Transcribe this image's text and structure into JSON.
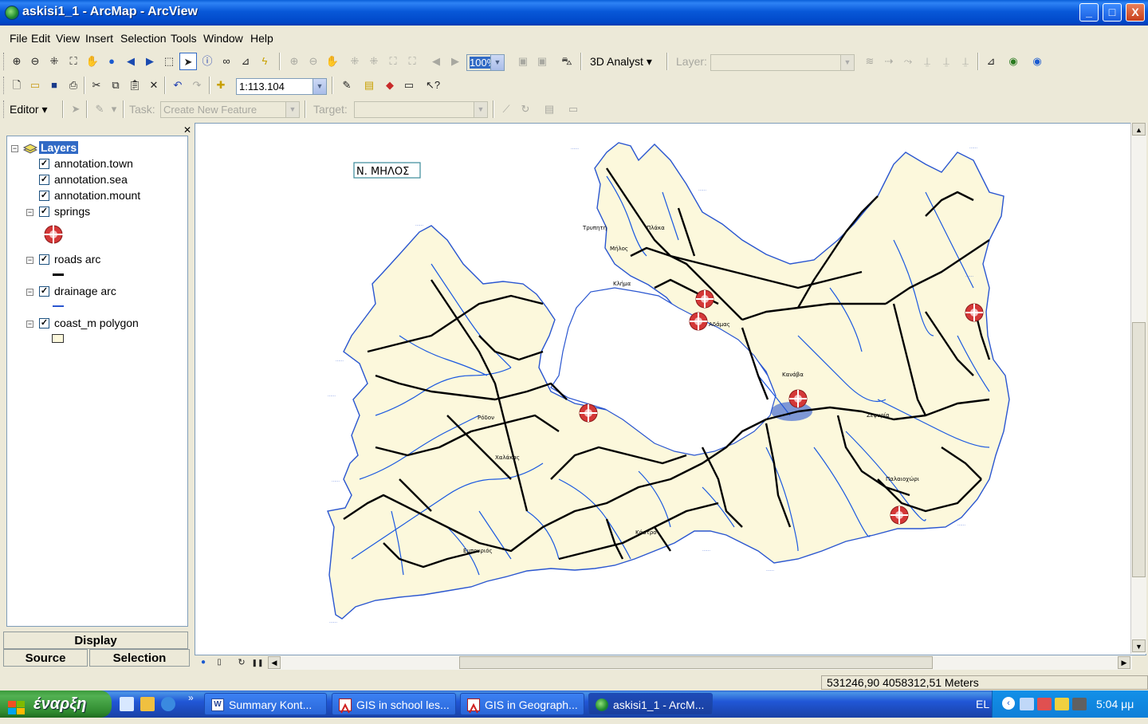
{
  "window": {
    "title": "askisi1_1 - ArcMap - ArcView",
    "buttons": {
      "minimize": "_",
      "maximize": "□",
      "close": "X"
    }
  },
  "menu": [
    "File",
    "Edit",
    "View",
    "Insert",
    "Selection",
    "Tools",
    "Window",
    "Help"
  ],
  "toolbar_tools": {
    "zoom_percent": "100%",
    "analyst_label": "3D Analyst",
    "layer_label": "Layer:",
    "layer_value": ""
  },
  "toolbar_standard": {
    "scale": "1:113.104"
  },
  "toolbar_editor": {
    "editor_label": "Editor",
    "task_label": "Task:",
    "task_value": "Create New Feature",
    "target_label": "Target:",
    "target_value": ""
  },
  "toc": {
    "root_label": "Layers",
    "layers": [
      {
        "name": "annotation.town",
        "checked": true
      },
      {
        "name": "annotation.sea",
        "checked": true
      },
      {
        "name": "annotation.mount",
        "checked": true
      },
      {
        "name": "springs",
        "checked": true,
        "symbol": "spring-symbol-icon"
      },
      {
        "name": "roads arc",
        "checked": true,
        "symbol": "black-line"
      },
      {
        "name": "drainage arc",
        "checked": true,
        "symbol": "blue-line"
      },
      {
        "name": "coast_m polygon",
        "checked": true,
        "symbol": "yellow-fill"
      }
    ],
    "tabs": {
      "display": "Display",
      "source": "Source",
      "selection": "Selection"
    }
  },
  "map": {
    "title_box": "Ν. ΜΗΛΟΣ",
    "labels": {
      "milos": "Μήλος",
      "kastro": "Κάστρο",
      "plaka": "Πλάκα",
      "adamas": "Αδάμας",
      "kanava": "Κανάβα",
      "zefiria": "Ζεφυρία",
      "paliochori": "Παλαιοχώρι",
      "embourios": "Εμπουριός",
      "rodon": "Ρόδον",
      "halakas": "Χαλάκας",
      "klima": "Κλήμα",
      "trypiti": "Τρυπητή"
    },
    "colors": {
      "land": "#fcf8dc",
      "coast": "#2a56d0",
      "drainage": "#1a58e0",
      "roads": "#000000",
      "spring": "#cc2a2a"
    }
  },
  "status": {
    "coordinates": "531246,90  4058312,51 Meters"
  },
  "taskbar": {
    "start": "έναρξη",
    "tasks": [
      {
        "label": "Summary Kont...",
        "icon": "word-doc-icon"
      },
      {
        "label": "GIS in school les...",
        "icon": "pdf-icon"
      },
      {
        "label": "GIS in Geograph...",
        "icon": "pdf-icon"
      },
      {
        "label": "askisi1_1 - ArcM...",
        "icon": "arcmap-icon",
        "active": true
      }
    ],
    "language": "EL",
    "time": "5:04 μμ"
  }
}
